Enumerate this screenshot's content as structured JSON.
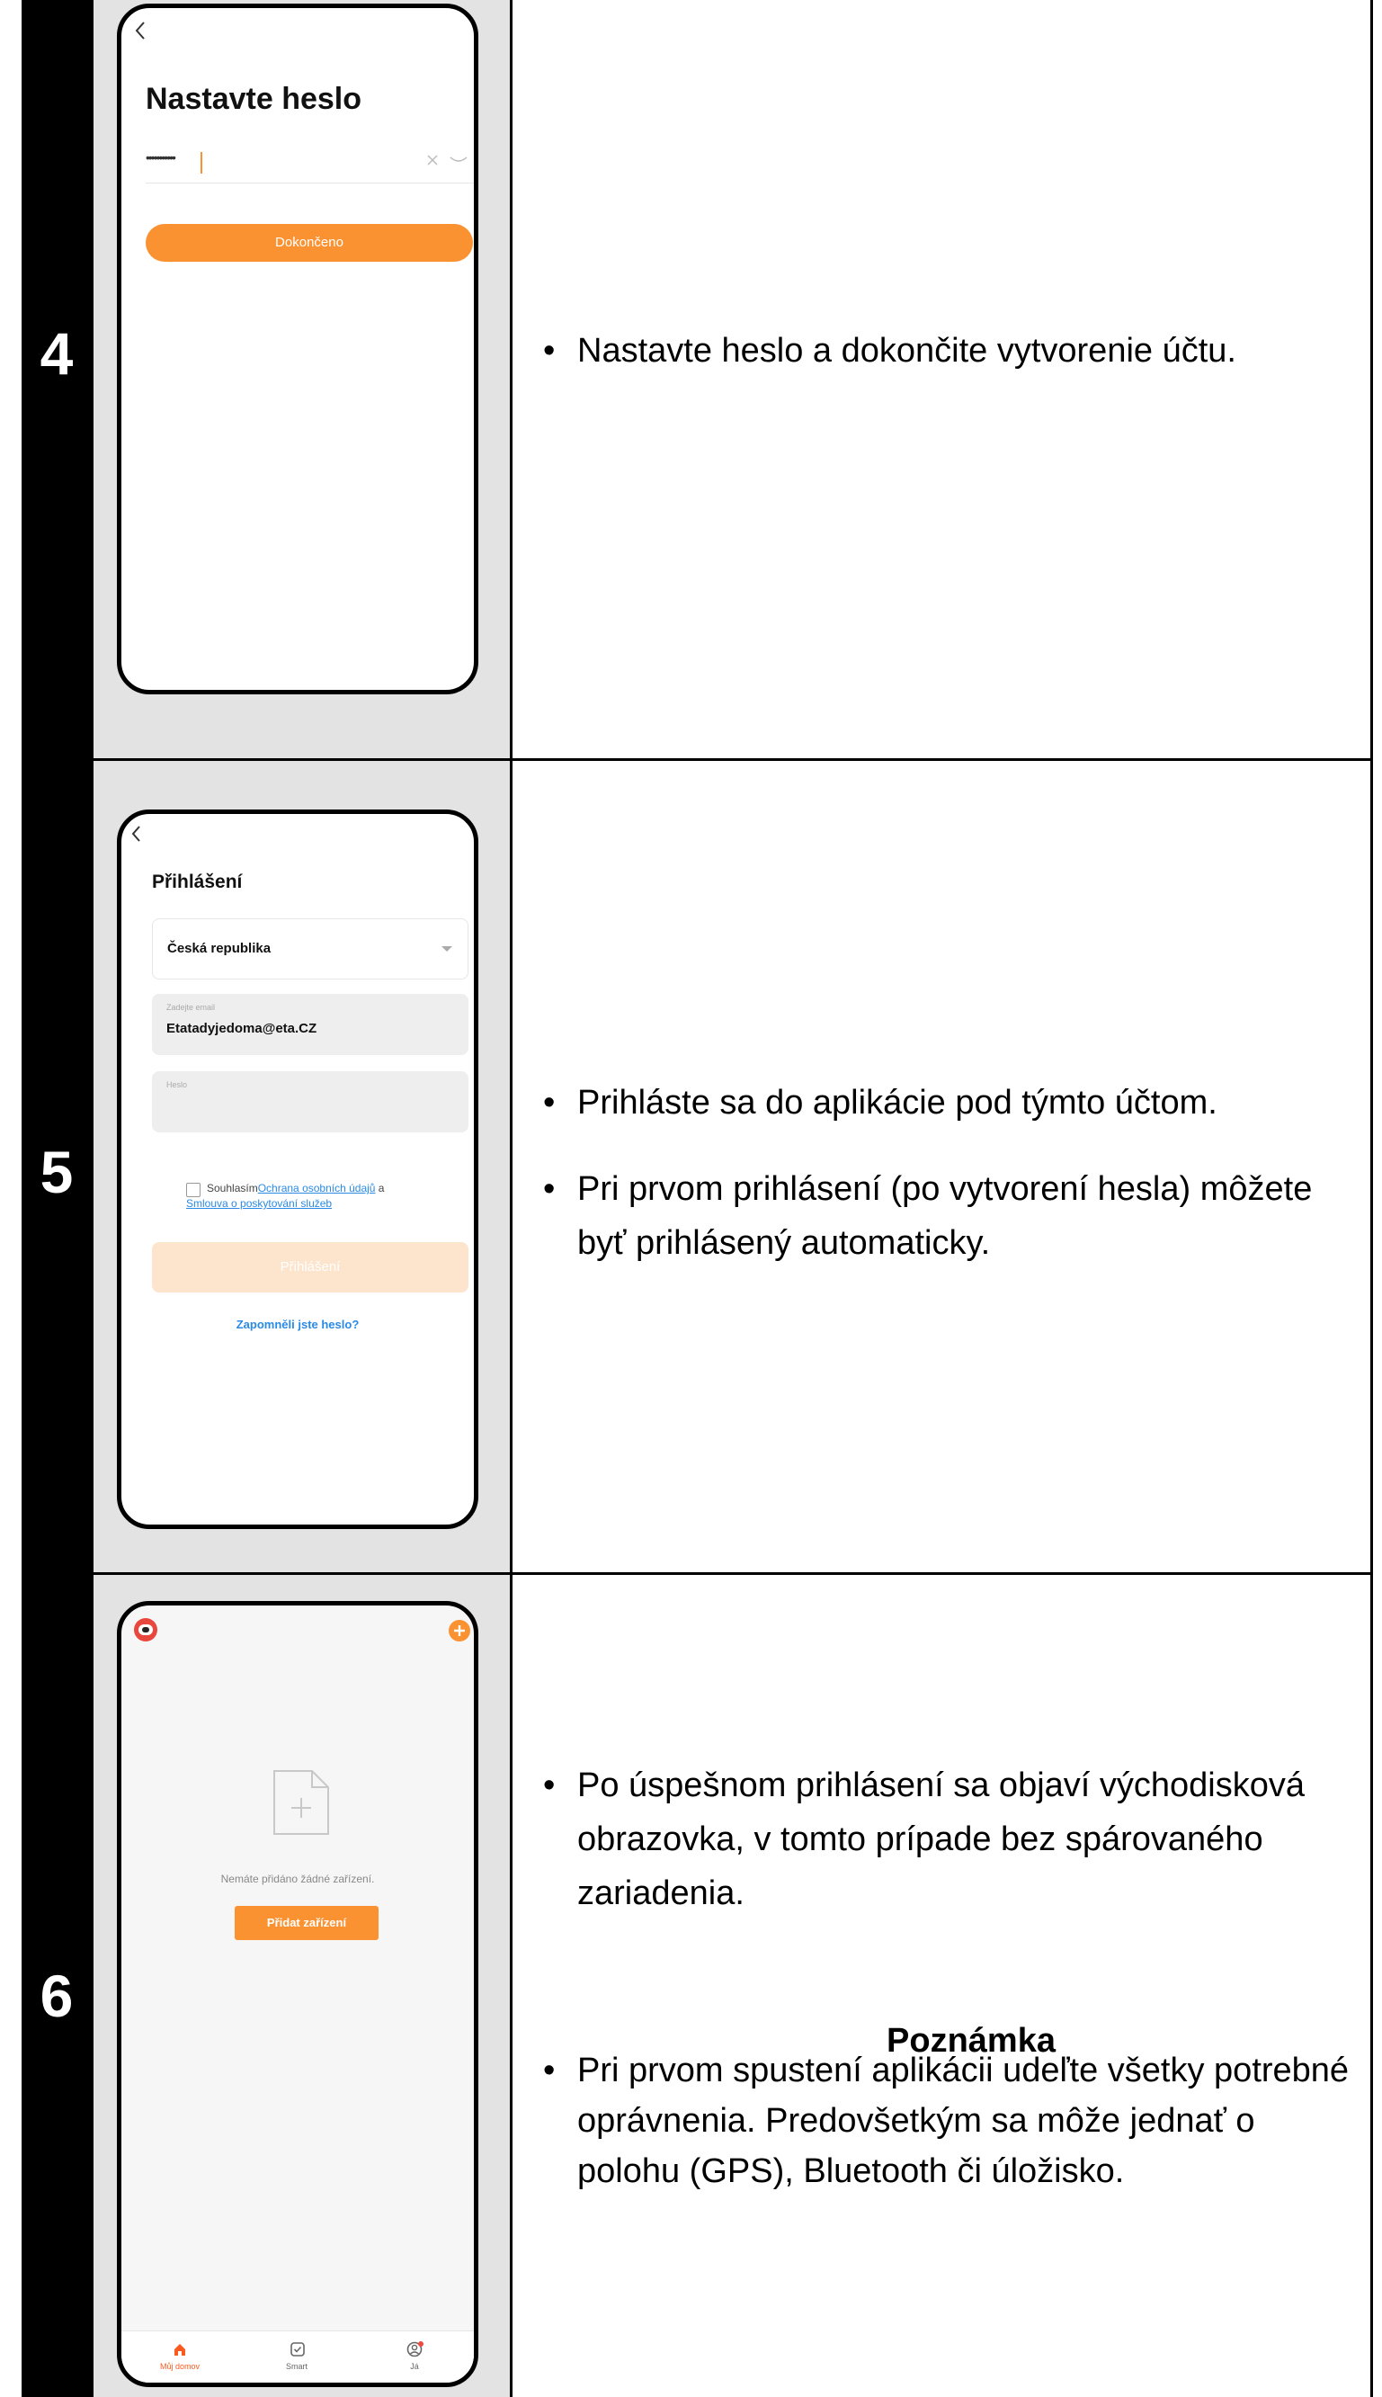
{
  "steps": [
    {
      "number": "4",
      "phone": {
        "title": "Nastavte heslo",
        "password_value": "•••••••••••",
        "button_label": "Dokončeno"
      },
      "bullets": [
        "Nastavte heslo a dokončite vytvorenie účtu."
      ]
    },
    {
      "number": "5",
      "phone": {
        "title": "Přihlášení",
        "country": "Česká republika",
        "email_label": "Zadejte email",
        "email_value": "Etatadyjedoma@eta.CZ",
        "password_label": "Heslo",
        "agree_prefix": "Souhlasím",
        "agree_link1": "Ochrana osobních údajů",
        "agree_and": " a",
        "agree_link2": "Smlouva o poskytování služeb",
        "login_button": "Přihlášení",
        "forgot_link": "Zapomněli jste heslo?"
      },
      "bullets": [
        "Prihláste sa do aplikácie pod týmto účtom.",
        "Pri prvom prihlásení (po vytvorení hesla) môžete byť prihlásený automaticky."
      ]
    },
    {
      "number": "6",
      "phone": {
        "empty_text": "Nemáte přidáno žádné zařízení.",
        "add_button": "Přidat zařízení",
        "tabs": [
          {
            "label": "Můj domov",
            "icon": "home-icon"
          },
          {
            "label": "Smart",
            "icon": "smart-icon"
          },
          {
            "label": "Já",
            "icon": "profile-icon"
          }
        ]
      },
      "bullets": [
        "Po úspešnom prihlásení sa objaví východisková obrazovka, v tomto prípade bez spárovaného zariadenia."
      ],
      "note_title": "Poznámka",
      "note_bullets": [
        "Pri prvom spustení aplikácii udeľte všetky potrebné oprávnenia. Predovšetkým sa môže jednať o polohu (GPS), Bluetooth či úložisko."
      ]
    }
  ],
  "bullet_symbol": "•",
  "colors": {
    "accent": "#fb9231",
    "link": "#2a8ae6",
    "shot_bg": "#e3e3e3"
  }
}
